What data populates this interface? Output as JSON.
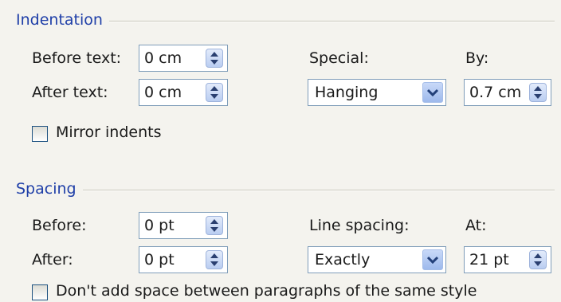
{
  "indentation": {
    "title": "Indentation",
    "before_text_label": "Before text:",
    "before_text_value": "0 cm",
    "after_text_label": "After text:",
    "after_text_value": "0 cm",
    "special_label": "Special:",
    "special_value": "Hanging",
    "by_label": "By:",
    "by_value": "0.7 cm",
    "mirror_indents_label": "Mirror indents",
    "mirror_indents_checked": false
  },
  "spacing": {
    "title": "Spacing",
    "before_label": "Before:",
    "before_value": "0 pt",
    "after_label": "After:",
    "after_value": "0 pt",
    "line_spacing_label": "Line spacing:",
    "line_spacing_value": "Exactly",
    "at_label": "At:",
    "at_value": "21 pt",
    "dont_add_space_label": "Don't add space between paragraphs of the same style",
    "dont_add_space_checked": false
  },
  "icons": {
    "spinner": "spinner-arrows-icon",
    "dropdown": "chevron-down-icon"
  },
  "colors": {
    "group_title": "#1f3fa8",
    "field_border": "#7f9db9",
    "background": "#f4f3ee"
  }
}
